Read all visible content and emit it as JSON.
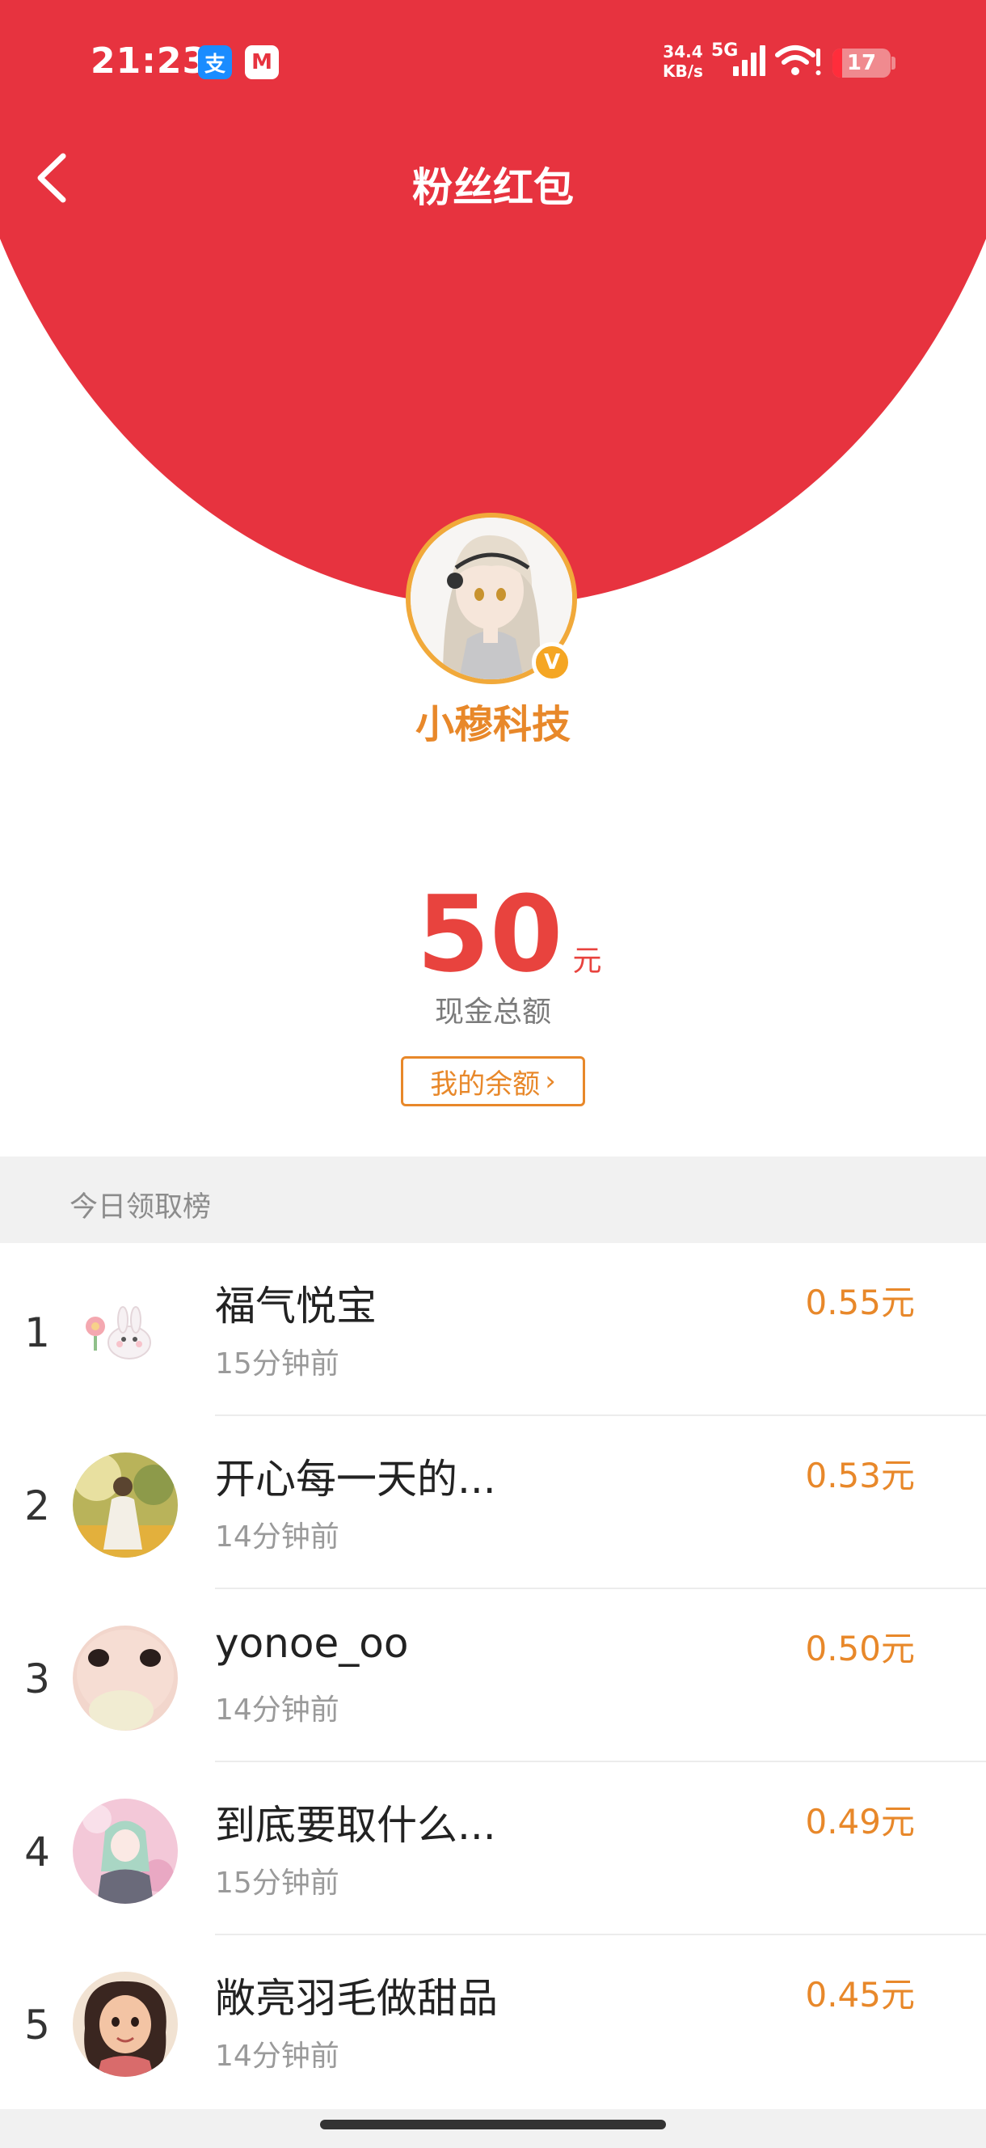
{
  "status_bar": {
    "time": "21:23",
    "apps": [
      {
        "icon": "alipay-icon",
        "glyph": "支"
      },
      {
        "icon": "cmb-bank-icon",
        "glyph": "M"
      }
    ],
    "net_speed_value": "34.4",
    "net_speed_unit": "KB/s",
    "network_type": "5G",
    "battery_level": "17"
  },
  "nav": {
    "title": "粉丝红包",
    "back_icon": "chevron-left-icon"
  },
  "account": {
    "name": "小穆科技",
    "verified_glyph": "V"
  },
  "amount": {
    "value": "50",
    "unit": "元",
    "label": "现金总额"
  },
  "balance_button": {
    "label": "我的余额",
    "chevron": "›"
  },
  "leaderboard": {
    "title": "今日领取榜",
    "rows": [
      {
        "rank": "1",
        "name": "福气悦宝",
        "time": "15分钟前",
        "amount": "0.55元"
      },
      {
        "rank": "2",
        "name": "开心每一天的...",
        "time": "14分钟前",
        "amount": "0.53元"
      },
      {
        "rank": "3",
        "name": "yonoe_oo",
        "time": "14分钟前",
        "amount": "0.50元"
      },
      {
        "rank": "4",
        "name": "到底要取什么...",
        "time": "15分钟前",
        "amount": "0.49元"
      },
      {
        "rank": "5",
        "name": "敞亮羽毛做甜品",
        "time": "14分钟前",
        "amount": "0.45元"
      }
    ]
  },
  "colors": {
    "header_red": "#e7333f",
    "accent_orange": "#e8882a",
    "amount_red": "#e8433e"
  }
}
